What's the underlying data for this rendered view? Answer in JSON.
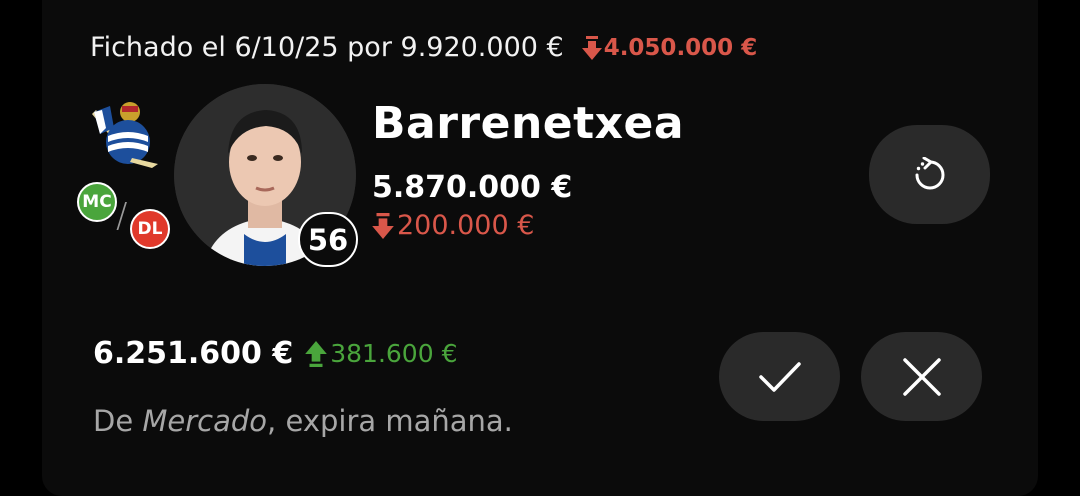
{
  "transfer": {
    "text": "Fichado el 6/10/25 por 9.920.000 €",
    "change": "4.050.000 €"
  },
  "player": {
    "name": "Barrenetxea",
    "value": "5.870.000 €",
    "value_change": "200.000 €",
    "points": "56",
    "positions": [
      "MC",
      "DL"
    ]
  },
  "offer": {
    "amount": "6.251.600 €",
    "change": "381.600 €",
    "note_prefix": "De ",
    "note_source": "Mercado",
    "note_suffix": ", expira mañana."
  },
  "colors": {
    "down": "#d9574a",
    "up": "#4aa53c",
    "button_bg": "#2a2a2a"
  },
  "icons": [
    "refresh-icon",
    "check-icon",
    "close-icon",
    "arrow-down-icon",
    "arrow-up-icon",
    "team-crest-icon"
  ]
}
